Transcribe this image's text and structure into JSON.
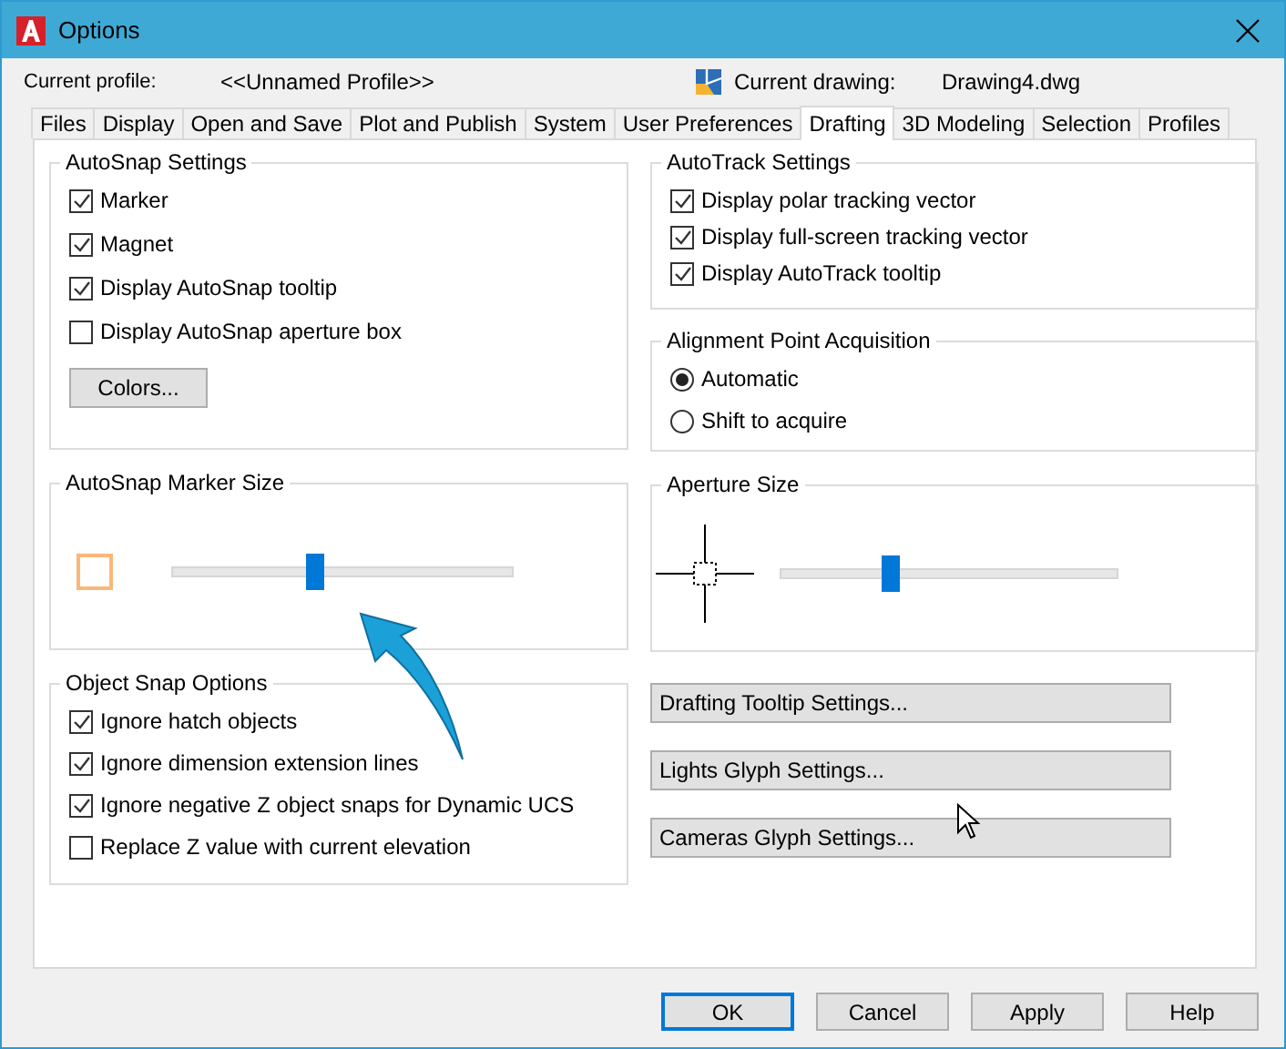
{
  "window": {
    "title": "Options"
  },
  "profile": {
    "label": "Current profile:",
    "value": "<<Unnamed Profile>>"
  },
  "drawing": {
    "label": "Current drawing:",
    "value": "Drawing4.dwg"
  },
  "tabs": [
    {
      "label": "Files",
      "selected": false
    },
    {
      "label": "Display",
      "selected": false
    },
    {
      "label": "Open and Save",
      "selected": false
    },
    {
      "label": "Plot and Publish",
      "selected": false
    },
    {
      "label": "System",
      "selected": false
    },
    {
      "label": "User Preferences",
      "selected": false
    },
    {
      "label": "Drafting",
      "selected": true
    },
    {
      "label": "3D Modeling",
      "selected": false
    },
    {
      "label": "Selection",
      "selected": false
    },
    {
      "label": "Profiles",
      "selected": false
    }
  ],
  "autosnap_settings": {
    "title": "AutoSnap Settings",
    "options": [
      {
        "label": "Marker",
        "checked": true
      },
      {
        "label": "Magnet",
        "checked": true
      },
      {
        "label": "Display AutoSnap tooltip",
        "checked": true
      },
      {
        "label": "Display AutoSnap aperture box",
        "checked": false
      }
    ],
    "button": "Colors..."
  },
  "autosnap_marker_size": {
    "title": "AutoSnap Marker Size",
    "level": 0.42
  },
  "object_snap_options": {
    "title": "Object Snap Options",
    "options": [
      {
        "label": "Ignore hatch objects",
        "checked": true
      },
      {
        "label": "Ignore dimension extension lines",
        "checked": true
      },
      {
        "label": "Ignore negative Z object snaps for Dynamic UCS",
        "checked": true
      },
      {
        "label": "Replace Z value with current elevation",
        "checked": false
      }
    ]
  },
  "autotrack_settings": {
    "title": "AutoTrack Settings",
    "options": [
      {
        "label": "Display polar tracking vector",
        "checked": true
      },
      {
        "label": "Display full-screen tracking vector",
        "checked": true
      },
      {
        "label": "Display AutoTrack tooltip",
        "checked": true
      }
    ]
  },
  "alignment_point_acquisition": {
    "title": "Alignment Point Acquisition",
    "options": [
      {
        "label": "Automatic",
        "selected": true
      },
      {
        "label": "Shift to acquire",
        "selected": false
      }
    ]
  },
  "aperture_size": {
    "title": "Aperture Size",
    "level": 0.33
  },
  "settings_buttons": [
    "Drafting Tooltip Settings...",
    "Lights Glyph Settings...",
    "Cameras Glyph Settings..."
  ],
  "footer_buttons": [
    {
      "label": "OK",
      "default": true
    },
    {
      "label": "Cancel",
      "default": false
    },
    {
      "label": "Apply",
      "default": false
    },
    {
      "label": "Help",
      "default": false
    }
  ]
}
